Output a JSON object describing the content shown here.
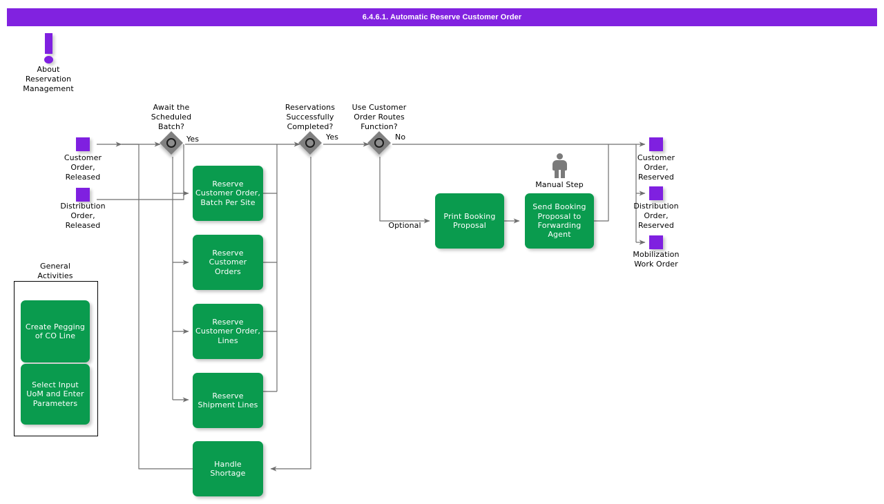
{
  "header": {
    "title": "6.4.6.1. Automatic Reserve Customer Order",
    "bar_color": "#8122e0",
    "text_color": "#ffffff"
  },
  "colors": {
    "process_green": "#0a9b4e",
    "data_purple": "#7f20e0",
    "decision_gray": "#808080",
    "connector_gray": "#6e6e6e",
    "person_gray": "#7a7a7a"
  },
  "info_note": {
    "icon": "exclamation-icon",
    "label": "About\nReservation\nManagement"
  },
  "inputs": [
    {
      "name": "customer-order-released",
      "icon": "data-square-icon",
      "label": "Customer\nOrder,\nReleased"
    },
    {
      "name": "distribution-order-released",
      "icon": "data-square-icon",
      "label": "Distribution\nOrder,\nReleased"
    }
  ],
  "decisions": [
    {
      "name": "await-scheduled-batch",
      "question": "Await the\nScheduled\nBatch?",
      "branch_label": "Yes"
    },
    {
      "name": "reservations-successfully-completed",
      "question": "Reservations\nSuccessfully\nCompleted?",
      "branch_label": "Yes"
    },
    {
      "name": "use-customer-order-routes-function",
      "question": "Use Customer\nOrder Routes\nFunction?",
      "branch_label": "No"
    }
  ],
  "edge_labels": {
    "optional": "Optional"
  },
  "processes": [
    {
      "name": "reserve-customer-order-batch-per-site",
      "label": "Reserve\nCustomer\nOrder, Batch\nPer Site"
    },
    {
      "name": "reserve-customer-orders",
      "label": "Reserve\nCustomer\nOrders"
    },
    {
      "name": "reserve-customer-order-lines",
      "label": "Reserve\nCustomer\nOrder, Lines"
    },
    {
      "name": "reserve-shipment-lines",
      "label": "Reserve\nShipment Lines"
    },
    {
      "name": "handle-shortage",
      "label": "Handle Shortage"
    },
    {
      "name": "print-booking-proposal",
      "label": "Print Booking\nProposal"
    },
    {
      "name": "send-booking-proposal-to-forwarding-agent",
      "label": "Send Booking\nProposal to\nForwarding\nAgent"
    }
  ],
  "manual_step": {
    "icon": "person-icon",
    "label": "Manual Step"
  },
  "general_activities": {
    "title": "General\nActivities",
    "items": [
      {
        "name": "create-pegging-of-co-line",
        "label": "Create Pegging\nof CO Line"
      },
      {
        "name": "select-input-uom-and-enter-parameters",
        "label": "Select Input\nUoM and Enter\nParameters"
      }
    ]
  },
  "outputs": [
    {
      "name": "customer-order-reserved",
      "icon": "data-square-icon",
      "label": "Customer\nOrder,\nReserved"
    },
    {
      "name": "distribution-order-reserved",
      "icon": "data-square-icon",
      "label": "Distribution\nOrder,\nReserved"
    },
    {
      "name": "mobilization-work-order",
      "icon": "data-square-icon",
      "label": "Mobilization\nWork Order"
    }
  ]
}
